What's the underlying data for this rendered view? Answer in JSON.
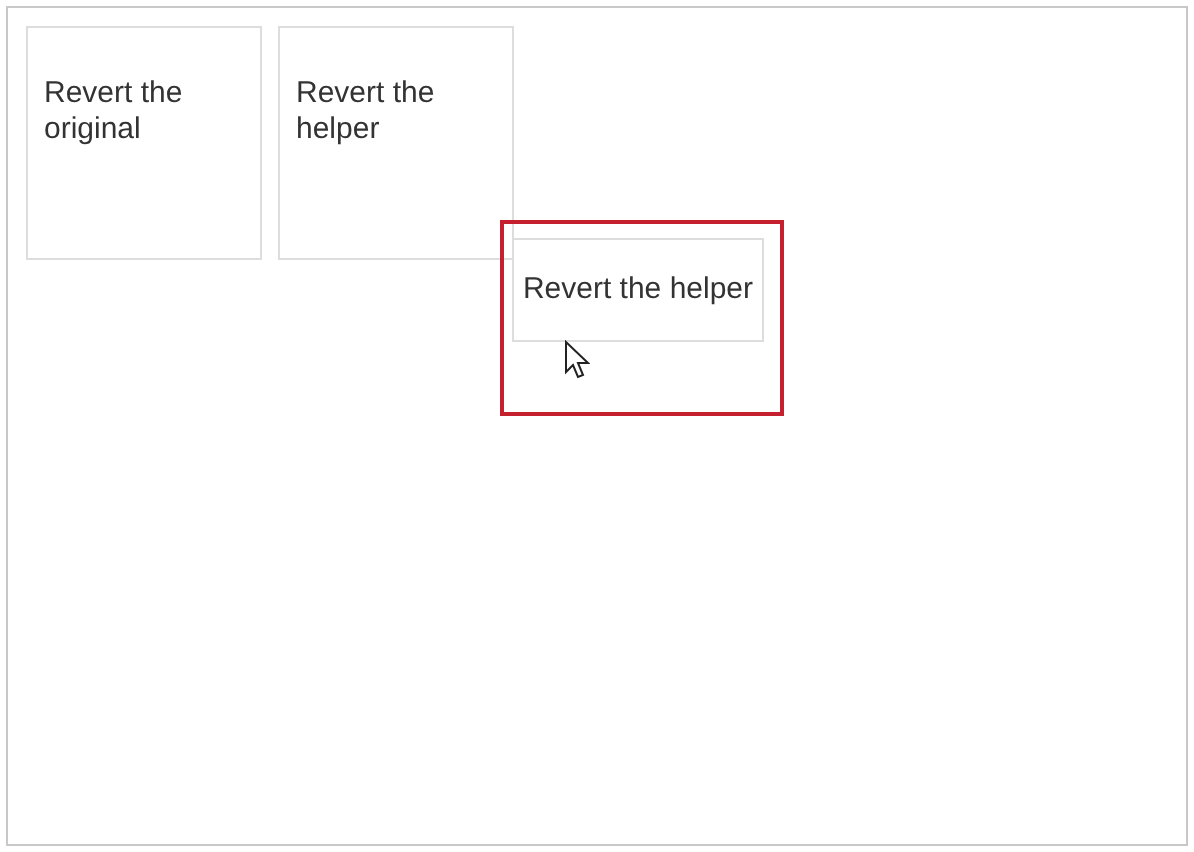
{
  "boxes": [
    {
      "label": "Revert the original"
    },
    {
      "label": "Revert the helper"
    }
  ],
  "drop_zone": {
    "highlighted": true
  },
  "helper": {
    "label": "Revert the helper"
  }
}
